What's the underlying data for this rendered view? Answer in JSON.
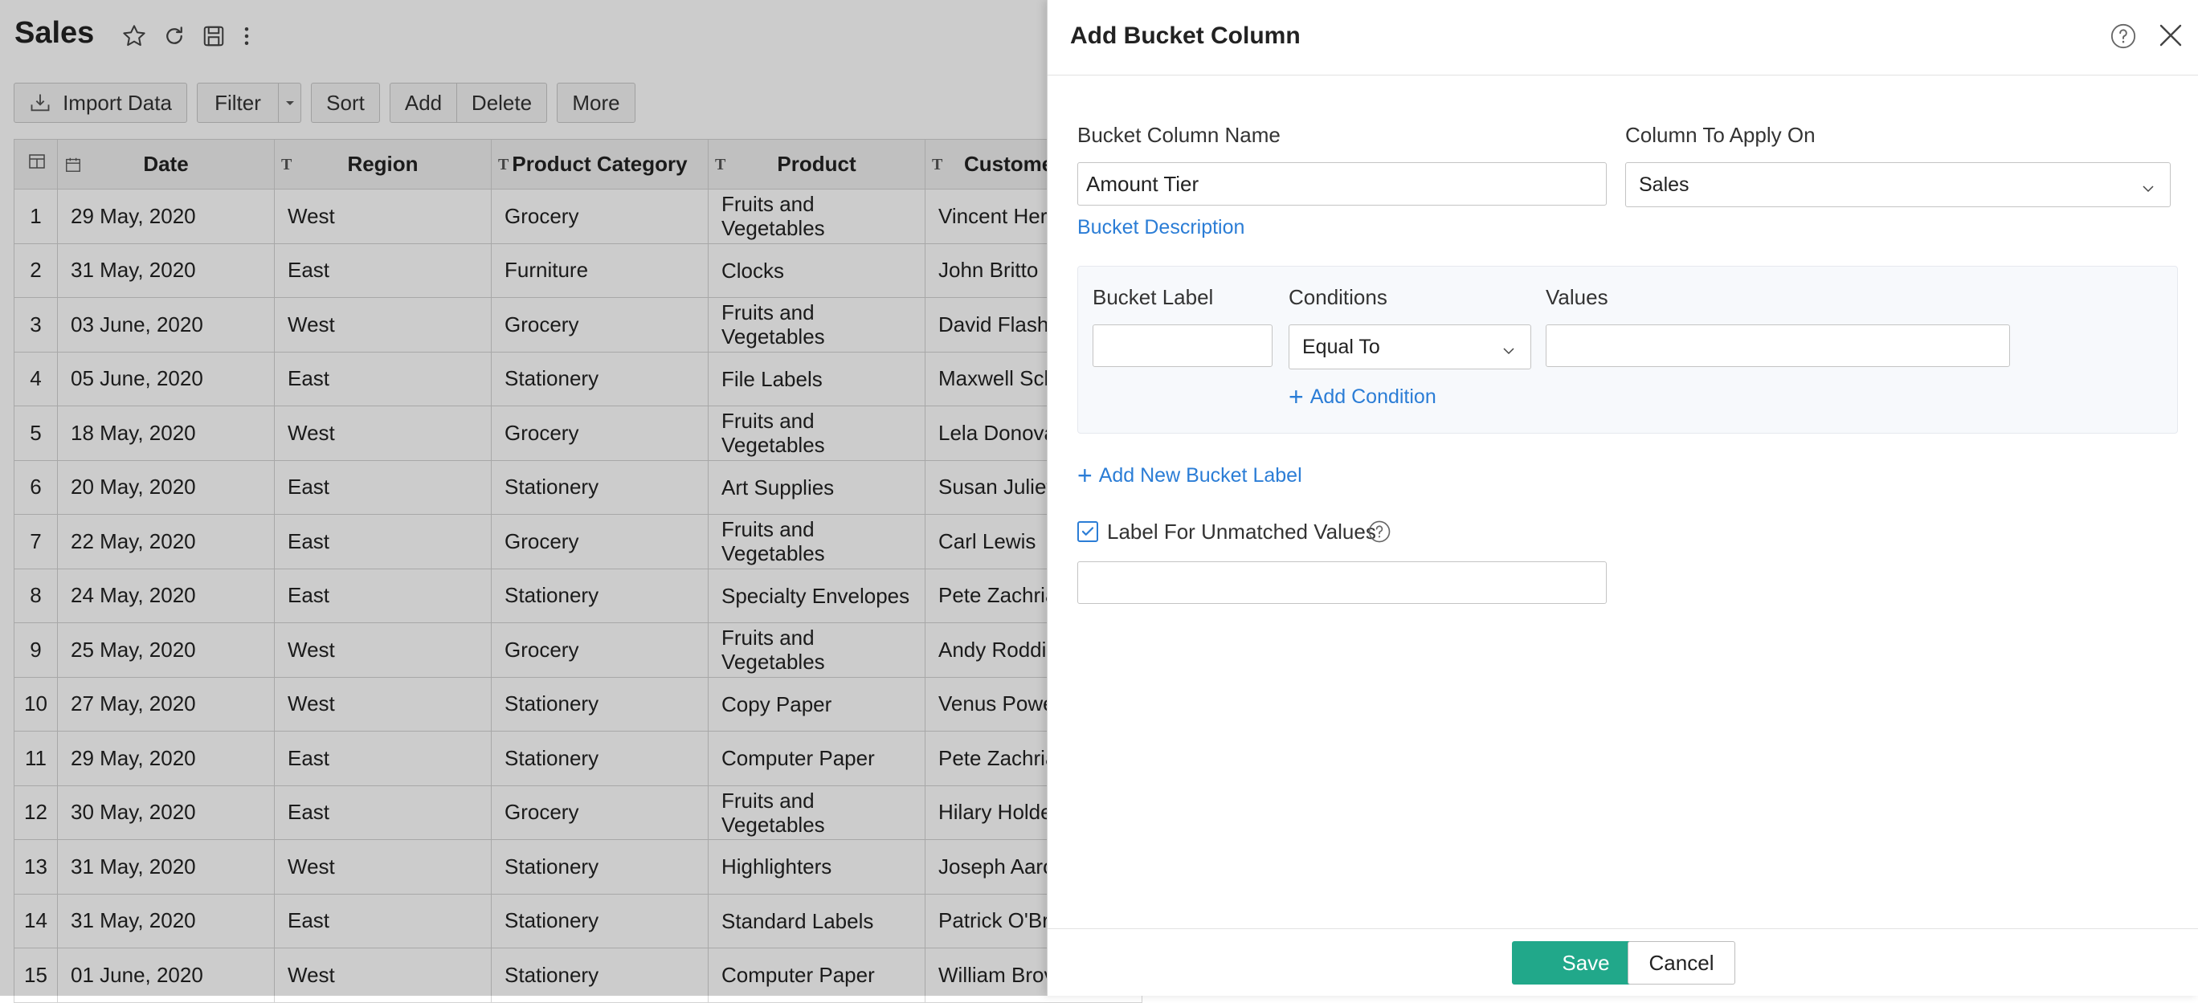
{
  "sheet": {
    "title": "Sales",
    "icons": [
      "star-icon",
      "refresh-icon",
      "save-icon",
      "more-vertical-icon"
    ],
    "toolbar": {
      "import_label": "Import Data",
      "filter_label": "Filter",
      "sort_label": "Sort",
      "add_label": "Add",
      "delete_label": "Delete",
      "more_label": "More"
    },
    "columns": [
      "Date",
      "Region",
      "Product Category",
      "Product",
      "Customer"
    ],
    "rows": [
      {
        "n": "1",
        "date": "29 May, 2020",
        "region": "West",
        "category": "Grocery",
        "product": "Fruits and Vegetables",
        "customer": "Vincent Herb"
      },
      {
        "n": "2",
        "date": "31 May, 2020",
        "region": "East",
        "category": "Furniture",
        "product": "Clocks",
        "customer": "John Britto"
      },
      {
        "n": "3",
        "date": "03 June, 2020",
        "region": "West",
        "category": "Grocery",
        "product": "Fruits and Vegetables",
        "customer": "David Flashi"
      },
      {
        "n": "4",
        "date": "05 June, 2020",
        "region": "East",
        "category": "Stationery",
        "product": "File Labels",
        "customer": "Maxwell Sch"
      },
      {
        "n": "5",
        "date": "18 May, 2020",
        "region": "West",
        "category": "Grocery",
        "product": "Fruits and Vegetables",
        "customer": "Lela Donova"
      },
      {
        "n": "6",
        "date": "20 May, 2020",
        "region": "East",
        "category": "Stationery",
        "product": "Art Supplies",
        "customer": "Susan Juliet"
      },
      {
        "n": "7",
        "date": "22 May, 2020",
        "region": "East",
        "category": "Grocery",
        "product": "Fruits and Vegetables",
        "customer": "Carl Lewis"
      },
      {
        "n": "8",
        "date": "24 May, 2020",
        "region": "East",
        "category": "Stationery",
        "product": "Specialty Envelopes",
        "customer": "Pete Zachria"
      },
      {
        "n": "9",
        "date": "25 May, 2020",
        "region": "West",
        "category": "Grocery",
        "product": "Fruits and Vegetables",
        "customer": "Andy Roddic"
      },
      {
        "n": "10",
        "date": "27 May, 2020",
        "region": "West",
        "category": "Stationery",
        "product": "Copy Paper",
        "customer": "Venus Powe"
      },
      {
        "n": "11",
        "date": "29 May, 2020",
        "region": "East",
        "category": "Stationery",
        "product": "Computer Paper",
        "customer": "Pete Zachria"
      },
      {
        "n": "12",
        "date": "30 May, 2020",
        "region": "East",
        "category": "Grocery",
        "product": "Fruits and Vegetables",
        "customer": "Hilary Holde"
      },
      {
        "n": "13",
        "date": "31 May, 2020",
        "region": "West",
        "category": "Stationery",
        "product": "Highlighters",
        "customer": "Joseph Aaro"
      },
      {
        "n": "14",
        "date": "31 May, 2020",
        "region": "East",
        "category": "Stationery",
        "product": "Standard Labels",
        "customer": "Patrick O'Br"
      },
      {
        "n": "15",
        "date": "01 June, 2020",
        "region": "West",
        "category": "Stationery",
        "product": "Computer Paper",
        "customer": "William Brov"
      }
    ]
  },
  "dialog": {
    "title": "Add Bucket Column",
    "bucket_name_label": "Bucket Column Name",
    "bucket_name_value": "Amount Tier",
    "column_apply_label": "Column To Apply On",
    "column_apply_value": "Sales",
    "bucket_description_link": "Bucket Description",
    "bucket_label_header": "Bucket Label",
    "conditions_header": "Conditions",
    "values_header": "Values",
    "condition_value": "Equal To",
    "add_condition_link": "Add Condition",
    "add_bucket_label_link": "Add New Bucket Label",
    "unmatched_label": "Label For Unmatched Values",
    "unmatched_checked": true,
    "save_label": "Save",
    "cancel_label": "Cancel",
    "accent_color": "#2b7dd6",
    "save_color": "#21a88a"
  }
}
